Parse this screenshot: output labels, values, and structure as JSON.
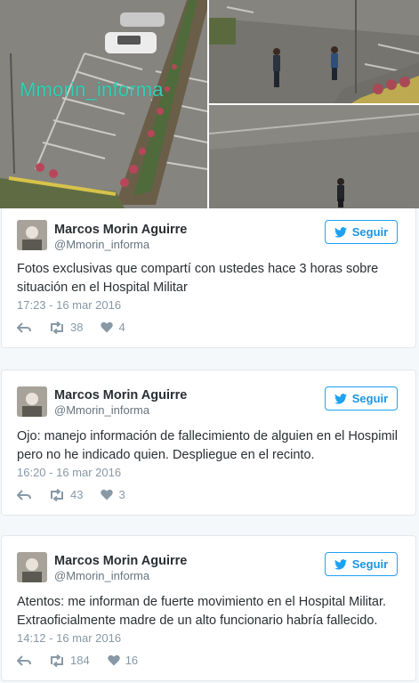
{
  "watermark": "Mmorin_informa",
  "follow_label": "Seguir",
  "tweets": [
    {
      "name": "Marcos Morin Aguirre",
      "handle": "@Mmorin_informa",
      "text_lines": [
        "Fotos exclusivas que compartí con ustedes hace 3 horas sobre",
        "situación en el Hospital Militar"
      ],
      "time": "17:23 - 16 mar 2016",
      "retweets": "38",
      "likes": "4"
    },
    {
      "name": "Marcos Morin Aguirre",
      "handle": "@Mmorin_informa",
      "text_lines": [
        "Ojo: manejo información de fallecimiento de alguien en el Hospimil",
        "pero no he indicado quien. Despliegue en el recinto."
      ],
      "time": "16:20 - 16 mar 2016",
      "retweets": "43",
      "likes": "3"
    },
    {
      "name": "Marcos Morin Aguirre",
      "handle": "@Mmorin_informa",
      "text_lines": [
        "Atentos: me informan de fuerte movimiento en el Hospital Militar.",
        "Extraoficialmente madre de un alto funcionario habría fallecido."
      ],
      "time": "14:12 - 16 mar 2016",
      "retweets": "184",
      "likes": "16"
    }
  ],
  "colors": {
    "accent": "#1da1f2",
    "meta": "#8899a6",
    "watermark": "#2fd3b5"
  },
  "icons": [
    "bird-icon",
    "reply-icon",
    "retweet-icon",
    "heart-icon"
  ]
}
